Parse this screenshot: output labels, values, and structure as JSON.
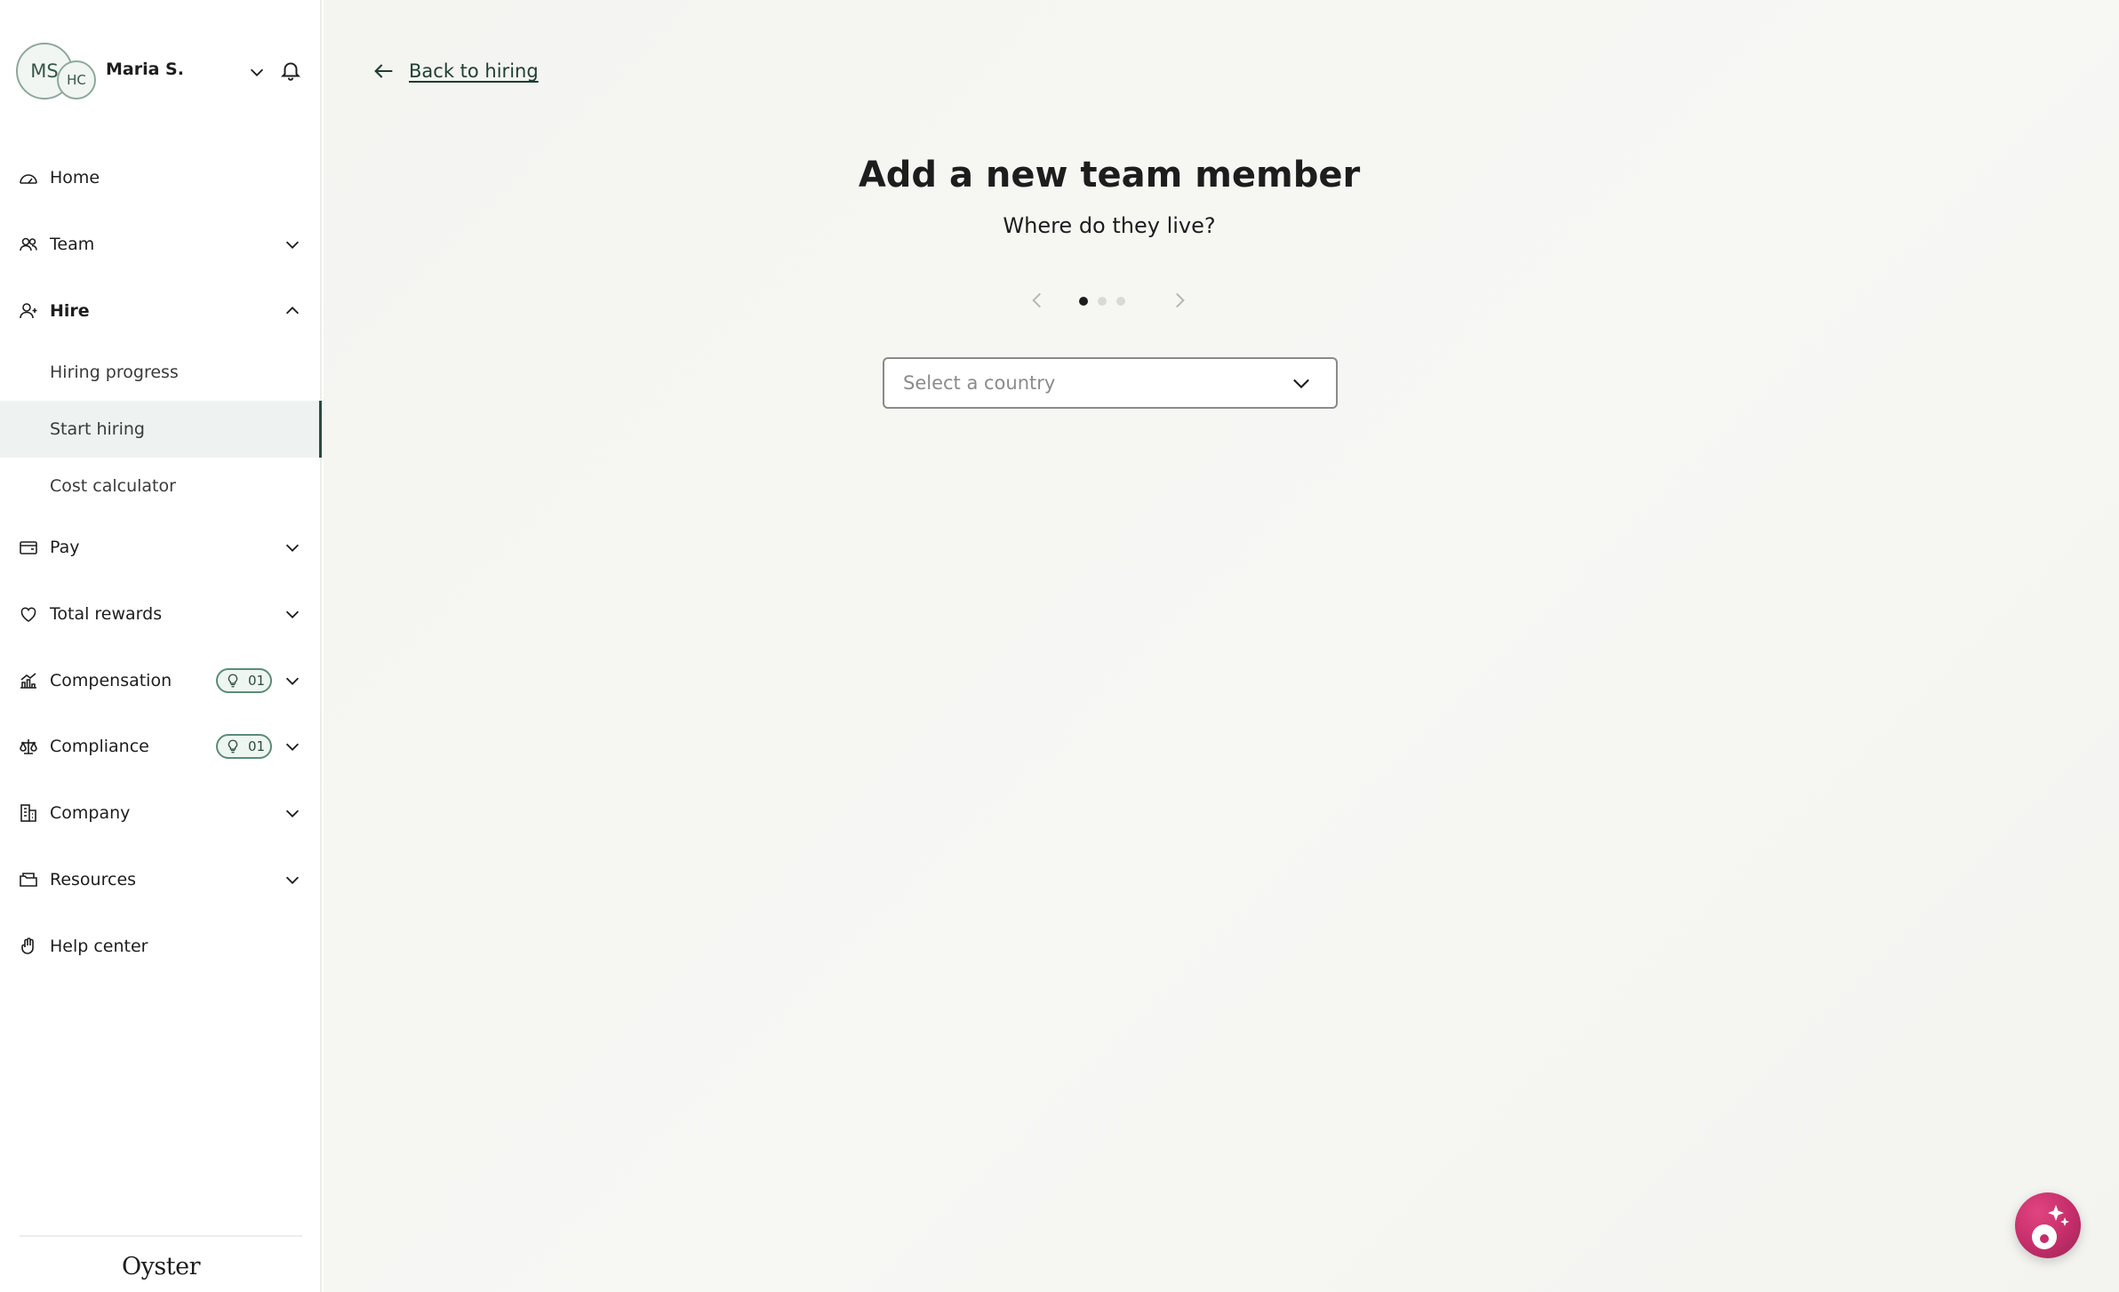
{
  "user": {
    "initials": "MS",
    "company_initials": "HC",
    "name": "Maria S."
  },
  "nav": {
    "home": "Home",
    "team": "Team",
    "hire": "Hire",
    "hire_sub": {
      "hiring_progress": "Hiring progress",
      "start_hiring": "Start hiring",
      "cost_calculator": "Cost calculator"
    },
    "pay": "Pay",
    "total_rewards": "Total rewards",
    "compensation": "Compensation",
    "compensation_badge": "01",
    "compliance": "Compliance",
    "compliance_badge": "01",
    "company": "Company",
    "resources": "Resources",
    "help_center": "Help center"
  },
  "brand": {
    "logo": "Oyster"
  },
  "main": {
    "back_link": "Back to hiring",
    "title": "Add a new team member",
    "subtitle": "Where do they live?",
    "step": {
      "current": 1,
      "total": 3
    },
    "country_select": {
      "placeholder": "Select a country"
    }
  },
  "colors": {
    "accent": "#2d4a3f",
    "active_bg": "#eef3f1",
    "assistant": "#c42d6a",
    "page_bg": "#f5f5f2"
  }
}
